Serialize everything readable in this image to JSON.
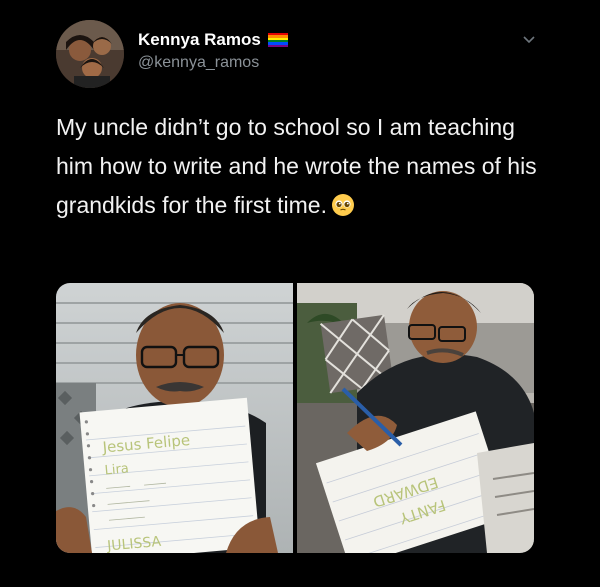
{
  "tweet": {
    "author_name": "Kennya Ramos",
    "author_handle": "@kennya_ramos",
    "text": "My uncle didn’t go to school so I am teaching him how to write and he wrote the names of his grandkids for the first time.",
    "emoji": "pleading-face-emoji",
    "flag": "rainbow-flag-icon",
    "menu_icon": "chevron-down-icon"
  },
  "media": {
    "left_notebook": {
      "line1": "Jesus Felipe",
      "line2": "Lira",
      "line3": "JULISSA"
    },
    "right_notebook": {
      "line1": "EDWARD",
      "line2": "FANTY"
    }
  },
  "colors": {
    "background": "#000000",
    "text": "#f2f2f2",
    "handle": "#8b9298"
  }
}
